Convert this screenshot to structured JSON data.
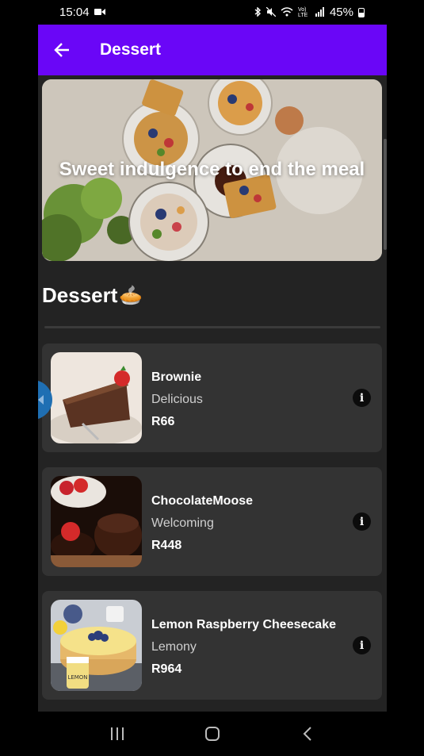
{
  "status_bar": {
    "time": "15:04",
    "battery": "45%",
    "network": "Vo) LTE"
  },
  "app_bar": {
    "title": "Dessert"
  },
  "hero": {
    "caption": "Sweet indulgence to end the meal"
  },
  "section": {
    "title": "Dessert",
    "emoji": "🥧"
  },
  "items": [
    {
      "name": "Brownie",
      "description": "Delicious",
      "price": "R66"
    },
    {
      "name": "ChocolateMoose",
      "description": "Welcoming",
      "price": "R448"
    },
    {
      "name": "Lemon Raspberry Cheesecake",
      "description": "Lemony",
      "price": "R964"
    }
  ],
  "icons": {
    "back": "arrow-left-icon",
    "info": "info-icon",
    "recents": "recent-apps-icon",
    "home": "home-icon",
    "nav_back": "chevron-left-icon"
  },
  "colors": {
    "app_bar": "#6a06f7",
    "background": "#232323",
    "card": "#333333"
  }
}
